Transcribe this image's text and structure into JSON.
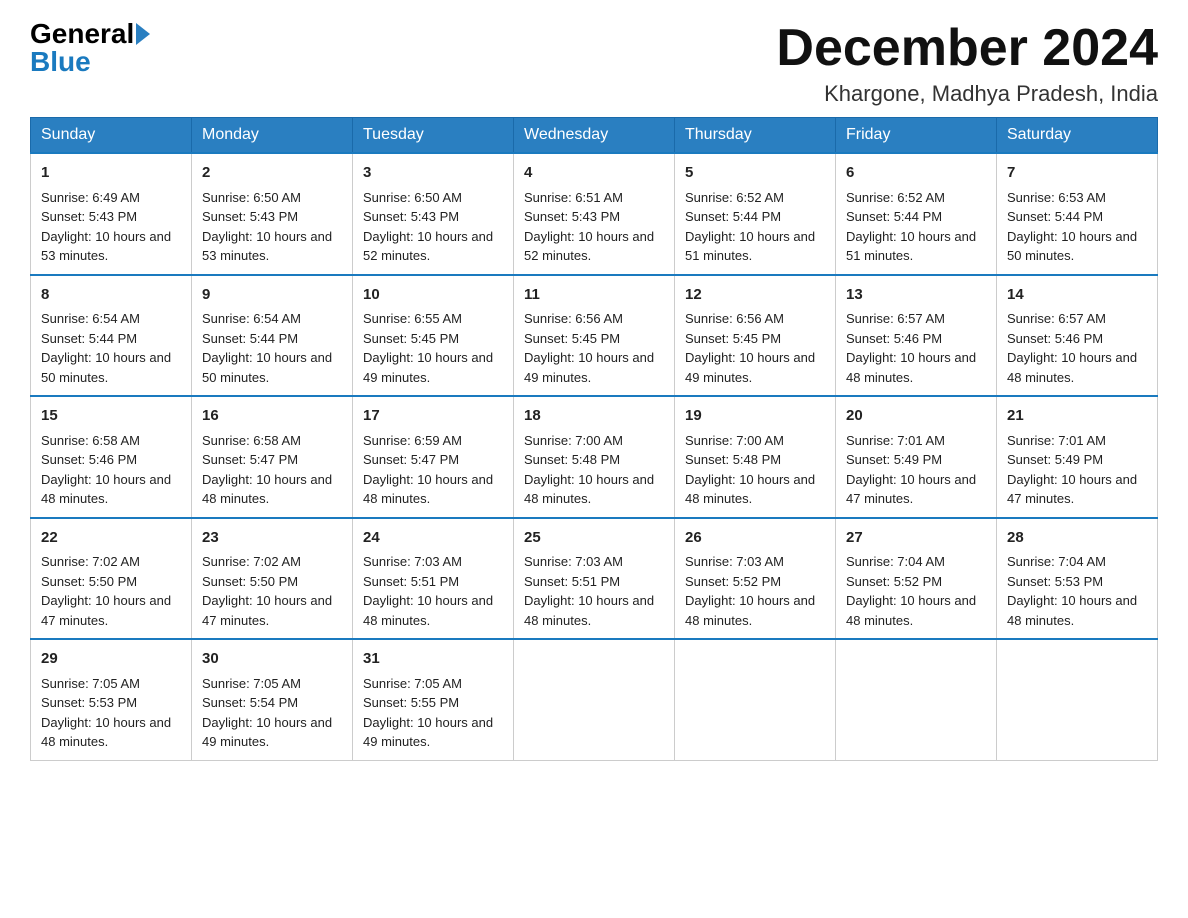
{
  "logo": {
    "general": "General",
    "blue": "Blue"
  },
  "title": "December 2024",
  "location": "Khargone, Madhya Pradesh, India",
  "days_of_week": [
    "Sunday",
    "Monday",
    "Tuesday",
    "Wednesday",
    "Thursday",
    "Friday",
    "Saturday"
  ],
  "weeks": [
    [
      {
        "day": "1",
        "sunrise": "6:49 AM",
        "sunset": "5:43 PM",
        "daylight": "10 hours and 53 minutes."
      },
      {
        "day": "2",
        "sunrise": "6:50 AM",
        "sunset": "5:43 PM",
        "daylight": "10 hours and 53 minutes."
      },
      {
        "day": "3",
        "sunrise": "6:50 AM",
        "sunset": "5:43 PM",
        "daylight": "10 hours and 52 minutes."
      },
      {
        "day": "4",
        "sunrise": "6:51 AM",
        "sunset": "5:43 PM",
        "daylight": "10 hours and 52 minutes."
      },
      {
        "day": "5",
        "sunrise": "6:52 AM",
        "sunset": "5:44 PM",
        "daylight": "10 hours and 51 minutes."
      },
      {
        "day": "6",
        "sunrise": "6:52 AM",
        "sunset": "5:44 PM",
        "daylight": "10 hours and 51 minutes."
      },
      {
        "day": "7",
        "sunrise": "6:53 AM",
        "sunset": "5:44 PM",
        "daylight": "10 hours and 50 minutes."
      }
    ],
    [
      {
        "day": "8",
        "sunrise": "6:54 AM",
        "sunset": "5:44 PM",
        "daylight": "10 hours and 50 minutes."
      },
      {
        "day": "9",
        "sunrise": "6:54 AM",
        "sunset": "5:44 PM",
        "daylight": "10 hours and 50 minutes."
      },
      {
        "day": "10",
        "sunrise": "6:55 AM",
        "sunset": "5:45 PM",
        "daylight": "10 hours and 49 minutes."
      },
      {
        "day": "11",
        "sunrise": "6:56 AM",
        "sunset": "5:45 PM",
        "daylight": "10 hours and 49 minutes."
      },
      {
        "day": "12",
        "sunrise": "6:56 AM",
        "sunset": "5:45 PM",
        "daylight": "10 hours and 49 minutes."
      },
      {
        "day": "13",
        "sunrise": "6:57 AM",
        "sunset": "5:46 PM",
        "daylight": "10 hours and 48 minutes."
      },
      {
        "day": "14",
        "sunrise": "6:57 AM",
        "sunset": "5:46 PM",
        "daylight": "10 hours and 48 minutes."
      }
    ],
    [
      {
        "day": "15",
        "sunrise": "6:58 AM",
        "sunset": "5:46 PM",
        "daylight": "10 hours and 48 minutes."
      },
      {
        "day": "16",
        "sunrise": "6:58 AM",
        "sunset": "5:47 PM",
        "daylight": "10 hours and 48 minutes."
      },
      {
        "day": "17",
        "sunrise": "6:59 AM",
        "sunset": "5:47 PM",
        "daylight": "10 hours and 48 minutes."
      },
      {
        "day": "18",
        "sunrise": "7:00 AM",
        "sunset": "5:48 PM",
        "daylight": "10 hours and 48 minutes."
      },
      {
        "day": "19",
        "sunrise": "7:00 AM",
        "sunset": "5:48 PM",
        "daylight": "10 hours and 48 minutes."
      },
      {
        "day": "20",
        "sunrise": "7:01 AM",
        "sunset": "5:49 PM",
        "daylight": "10 hours and 47 minutes."
      },
      {
        "day": "21",
        "sunrise": "7:01 AM",
        "sunset": "5:49 PM",
        "daylight": "10 hours and 47 minutes."
      }
    ],
    [
      {
        "day": "22",
        "sunrise": "7:02 AM",
        "sunset": "5:50 PM",
        "daylight": "10 hours and 47 minutes."
      },
      {
        "day": "23",
        "sunrise": "7:02 AM",
        "sunset": "5:50 PM",
        "daylight": "10 hours and 47 minutes."
      },
      {
        "day": "24",
        "sunrise": "7:03 AM",
        "sunset": "5:51 PM",
        "daylight": "10 hours and 48 minutes."
      },
      {
        "day": "25",
        "sunrise": "7:03 AM",
        "sunset": "5:51 PM",
        "daylight": "10 hours and 48 minutes."
      },
      {
        "day": "26",
        "sunrise": "7:03 AM",
        "sunset": "5:52 PM",
        "daylight": "10 hours and 48 minutes."
      },
      {
        "day": "27",
        "sunrise": "7:04 AM",
        "sunset": "5:52 PM",
        "daylight": "10 hours and 48 minutes."
      },
      {
        "day": "28",
        "sunrise": "7:04 AM",
        "sunset": "5:53 PM",
        "daylight": "10 hours and 48 minutes."
      }
    ],
    [
      {
        "day": "29",
        "sunrise": "7:05 AM",
        "sunset": "5:53 PM",
        "daylight": "10 hours and 48 minutes."
      },
      {
        "day": "30",
        "sunrise": "7:05 AM",
        "sunset": "5:54 PM",
        "daylight": "10 hours and 49 minutes."
      },
      {
        "day": "31",
        "sunrise": "7:05 AM",
        "sunset": "5:55 PM",
        "daylight": "10 hours and 49 minutes."
      },
      null,
      null,
      null,
      null
    ]
  ]
}
